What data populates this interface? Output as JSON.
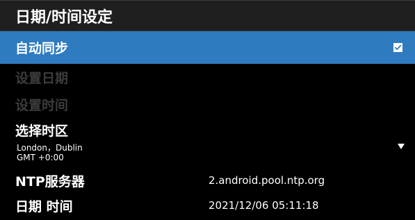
{
  "header": {
    "title": "日期/时间设定"
  },
  "rows": {
    "auto_sync": {
      "label": "自动同步",
      "checked": true
    },
    "set_date": {
      "label": "设置日期",
      "enabled": false
    },
    "set_time": {
      "label": "设置时间",
      "enabled": false
    },
    "timezone": {
      "label": "选择时区",
      "city": "London，Dublin",
      "offset": "GMT +0:00"
    },
    "ntp": {
      "label": "NTP服务器",
      "value": "2.android.pool.ntp.org"
    },
    "datetime": {
      "label": "日期 时间",
      "value": "2021/12/06 05:11:18"
    }
  },
  "colors": {
    "highlight": "#2f7bc0",
    "disabled_text": "#3c3c3c",
    "background": "#000000",
    "header_background": "#1f1f1f"
  },
  "icons": {
    "checkbox": "checkbox-checked-icon",
    "dropdown": "triangle-down-icon"
  }
}
